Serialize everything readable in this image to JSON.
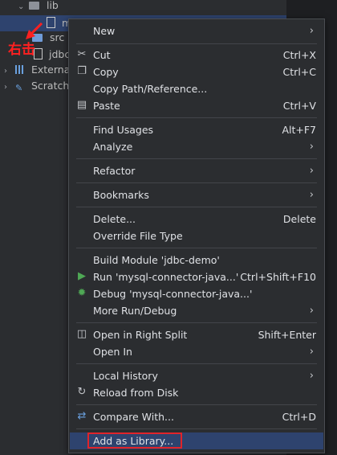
{
  "tree": {
    "rows": [
      {
        "label": "lib"
      },
      {
        "label": "m"
      },
      {
        "label": "src"
      },
      {
        "label": "jdbc"
      },
      {
        "label": "External"
      },
      {
        "label": "Scratch"
      }
    ]
  },
  "annotation": {
    "text": "右击"
  },
  "menu": {
    "items": [
      {
        "label": "New",
        "shortcut": "",
        "submenu": true
      },
      {
        "label": "Cut",
        "shortcut": "Ctrl+X",
        "icon": "scissors-icon"
      },
      {
        "label": "Copy",
        "shortcut": "Ctrl+C",
        "icon": "copy-icon"
      },
      {
        "label": "Copy Path/Reference...",
        "shortcut": ""
      },
      {
        "label": "Paste",
        "shortcut": "Ctrl+V",
        "icon": "paste-icon"
      },
      {
        "label": "Find Usages",
        "shortcut": "Alt+F7"
      },
      {
        "label": "Analyze",
        "shortcut": "",
        "submenu": true
      },
      {
        "label": "Refactor",
        "shortcut": "",
        "submenu": true
      },
      {
        "label": "Bookmarks",
        "shortcut": "",
        "submenu": true
      },
      {
        "label": "Delete...",
        "shortcut": "Delete"
      },
      {
        "label": "Override File Type",
        "shortcut": ""
      },
      {
        "label": "Build Module 'jdbc-demo'",
        "shortcut": ""
      },
      {
        "label": "Run 'mysql-connector-java...'",
        "shortcut": "Ctrl+Shift+F10",
        "icon": "run-icon"
      },
      {
        "label": "Debug 'mysql-connector-java...'",
        "shortcut": "",
        "icon": "debug-icon"
      },
      {
        "label": "More Run/Debug",
        "shortcut": "",
        "submenu": true
      },
      {
        "label": "Open in Right Split",
        "shortcut": "Shift+Enter",
        "icon": "split-icon"
      },
      {
        "label": "Open In",
        "shortcut": "",
        "submenu": true
      },
      {
        "label": "Local History",
        "shortcut": "",
        "submenu": true
      },
      {
        "label": "Reload from Disk",
        "shortcut": "",
        "icon": "reload-icon"
      },
      {
        "label": "Compare With...",
        "shortcut": "Ctrl+D",
        "icon": "compare-icon"
      },
      {
        "label": "Add as Library...",
        "shortcut": ""
      }
    ]
  },
  "colors": {
    "highlight": "#2e436e",
    "annotation_red": "#e0242a",
    "run_green": "#4fa855"
  }
}
